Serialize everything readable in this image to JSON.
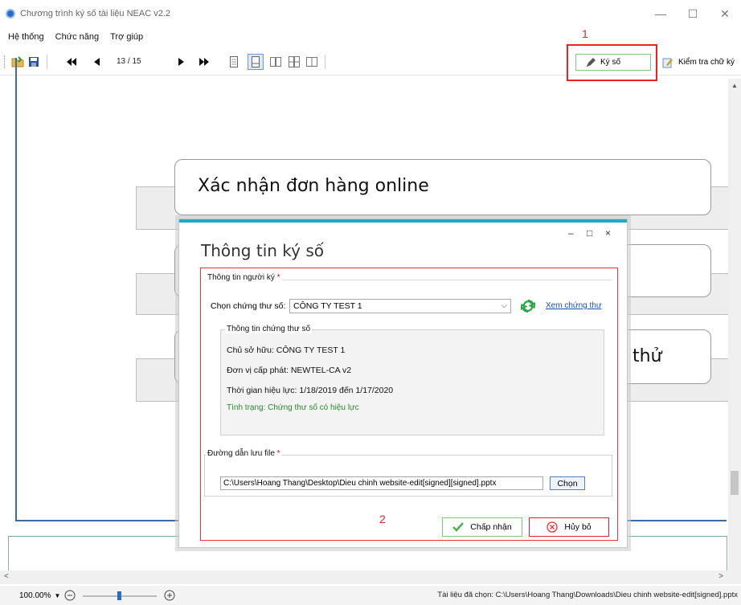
{
  "window": {
    "title": "Chương trình ký số tài liệu NEAC v2.2",
    "controls": {
      "minimize": "—",
      "maximize": "☐",
      "close": "✕"
    }
  },
  "menu": [
    "Hệ thống",
    "Chức năng",
    "Trợ giúp"
  ],
  "toolbar": {
    "page_counter": "13 / 15",
    "sign_label": "Ký số",
    "check_label": "Kiểm tra chữ ký",
    "icons": [
      "open-folder-icon",
      "save-icon",
      "first-page-icon",
      "prev-page-icon",
      "next-page-icon",
      "last-page-icon",
      "single-page-icon",
      "continuous-page-icon",
      "two-page-icon",
      "two-page-continuous-icon",
      "book-view-icon"
    ]
  },
  "annotations": {
    "step1": "1",
    "step2": "2"
  },
  "slide": {
    "heading": "Xác nhận đơn hàng online",
    "partial_text": "g thử"
  },
  "dialog": {
    "title": "Thông tin ký số",
    "controls": {
      "minimize": "–",
      "maximize": "□",
      "close": "×"
    },
    "signer_group": "Thông tin người ký",
    "cert_label": "Chọn chứng thư số:",
    "cert_selected": "CÔNG TY TEST 1",
    "view_cert_link": "Xem chứng thư",
    "cert_info_group": "Thông tin chứng thư số",
    "owner": "Chủ sở hữu: CÔNG TY TEST 1",
    "issuer": "Đơn vị cấp phát: NEWTEL-CA v2",
    "validity": "Thời gian hiệu lực: 1/18/2019 đến 1/17/2020",
    "status": "Tình trạng: Chứng thư số có hiệu lực",
    "path_group": "Đường dẫn lưu file",
    "path_value": "C:\\Users\\Hoang Thang\\Desktop\\Dieu chinh website-edit[signed][signed].pptx",
    "choose_label": "Chọn",
    "accept_label": "Chấp nhận",
    "cancel_label": "Hủy bỏ",
    "required_mark": "*"
  },
  "statusbar": {
    "zoom": "100.00%",
    "selected_file": "Tài liệu đã chọn: C:\\Users\\Hoang Thang\\Downloads\\Dieu chinh website-edit[signed].pptx"
  },
  "colors": {
    "accent": "#22a7c9",
    "highlight": "#e22222",
    "valid": "#2a8a2a",
    "link": "#1a4fb8"
  }
}
